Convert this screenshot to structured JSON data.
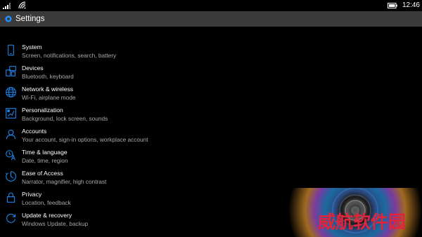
{
  "status_bar": {
    "time": "12:46",
    "icons": [
      "signal-icon",
      "wifi-icon",
      "battery-icon"
    ]
  },
  "title_bar": {
    "title": "Settings",
    "icon": "gear-icon"
  },
  "accent_color": "#1e90ff",
  "items": [
    {
      "title": "System",
      "subtitle": "Screen, notifications, search, battery",
      "icon": "phone-icon"
    },
    {
      "title": "Devices",
      "subtitle": "Bluetooth, keyboard",
      "icon": "devices-icon"
    },
    {
      "title": "Network & wireless",
      "subtitle": "Wi-Fi, airplane mode",
      "icon": "globe-icon"
    },
    {
      "title": "Personalization",
      "subtitle": "Background, lock screen, sounds",
      "icon": "paintbrush-icon"
    },
    {
      "title": "Accounts",
      "subtitle": "Your account, sign-in options, workplace account",
      "icon": "person-icon"
    },
    {
      "title": "Time & language",
      "subtitle": "Date, time, region",
      "icon": "time-language-icon"
    },
    {
      "title": "Ease of Access",
      "subtitle": "Narrator, magnifier, high contrast",
      "icon": "ease-of-access-icon"
    },
    {
      "title": "Privacy",
      "subtitle": "Location, feedback",
      "icon": "lock-icon"
    },
    {
      "title": "Update & recovery",
      "subtitle": "Windows Update, backup",
      "icon": "update-icon"
    }
  ],
  "watermark": "威航软件园"
}
